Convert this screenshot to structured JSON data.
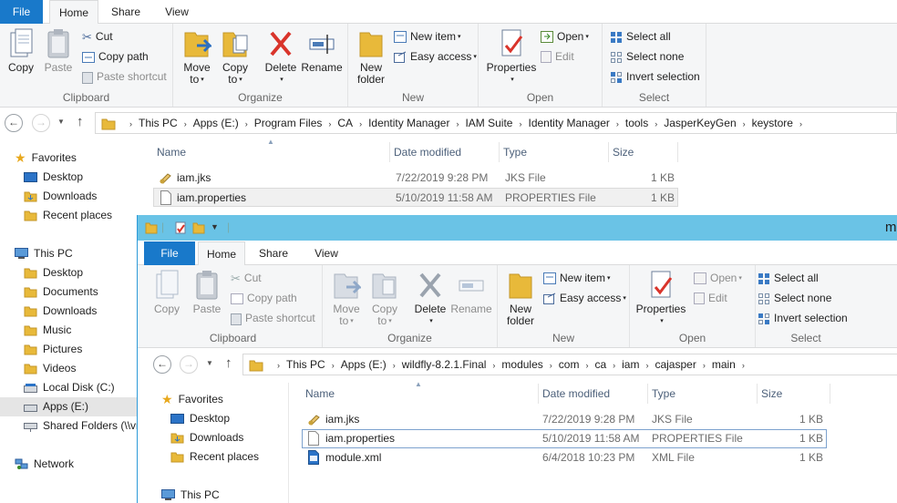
{
  "back_window": {
    "tabs": {
      "file": "File",
      "home": "Home",
      "share": "Share",
      "view": "View"
    },
    "ribbon": {
      "clipboard": {
        "label": "Clipboard",
        "copy": "Copy",
        "paste": "Paste",
        "cut": "Cut",
        "copy_path": "Copy path",
        "paste_shortcut": "Paste shortcut"
      },
      "organize": {
        "label": "Organize",
        "move_to": "Move",
        "move_to2": "to",
        "copy_to": "Copy",
        "copy_to2": "to",
        "delete": "Delete",
        "rename": "Rename"
      },
      "new": {
        "label": "New",
        "new_folder": "New",
        "new_folder2": "folder",
        "new_item": "New item",
        "easy_access": "Easy access"
      },
      "open": {
        "label": "Open",
        "properties": "Properties",
        "open": "Open",
        "edit": "Edit"
      },
      "select": {
        "label": "Select",
        "select_all": "Select all",
        "select_none": "Select none",
        "invert_selection": "Invert selection"
      }
    },
    "address": [
      "This PC",
      "Apps (E:)",
      "Program Files",
      "CA",
      "Identity Manager",
      "IAM Suite",
      "Identity Manager",
      "tools",
      "JasperKeyGen",
      "keystore"
    ],
    "nav": {
      "favorites": "Favorites",
      "desktop": "Desktop",
      "downloads": "Downloads",
      "recent": "Recent places",
      "this_pc": "This PC",
      "pc_desktop": "Desktop",
      "documents": "Documents",
      "pc_downloads": "Downloads",
      "music": "Music",
      "pictures": "Pictures",
      "videos": "Videos",
      "local_disk": "Local Disk (C:)",
      "apps": "Apps (E:)",
      "shared": "Shared Folders (\\\\vm",
      "network": "Network"
    },
    "columns": {
      "name": "Name",
      "date": "Date modified",
      "type": "Type",
      "size": "Size"
    },
    "files": [
      {
        "name": "iam.jks",
        "date": "7/22/2019 9:28 PM",
        "type": "JKS File",
        "size": "1 KB"
      },
      {
        "name": "iam.properties",
        "date": "5/10/2019 11:58 AM",
        "type": "PROPERTIES File",
        "size": "1 KB"
      }
    ]
  },
  "front_window": {
    "title": "ma",
    "tabs": {
      "file": "File",
      "home": "Home",
      "share": "Share",
      "view": "View"
    },
    "ribbon": {
      "clipboard": {
        "label": "Clipboard",
        "copy": "Copy",
        "paste": "Paste",
        "cut": "Cut",
        "copy_path": "Copy path",
        "paste_shortcut": "Paste shortcut"
      },
      "organize": {
        "label": "Organize",
        "move_to": "Move",
        "move_to2": "to",
        "copy_to": "Copy",
        "copy_to2": "to",
        "delete": "Delete",
        "rename": "Rename"
      },
      "new": {
        "label": "New",
        "new_folder": "New",
        "new_folder2": "folder",
        "new_item": "New item",
        "easy_access": "Easy access"
      },
      "open": {
        "label": "Open",
        "properties": "Properties",
        "open": "Open",
        "edit": "Edit"
      },
      "select": {
        "label": "Select",
        "select_all": "Select all",
        "select_none": "Select none",
        "invert_selection": "Invert selection"
      }
    },
    "address": [
      "This PC",
      "Apps (E:)",
      "wildfly-8.2.1.Final",
      "modules",
      "com",
      "ca",
      "iam",
      "cajasper",
      "main"
    ],
    "nav": {
      "favorites": "Favorites",
      "desktop": "Desktop",
      "downloads": "Downloads",
      "recent": "Recent places",
      "this_pc": "This PC"
    },
    "columns": {
      "name": "Name",
      "date": "Date modified",
      "type": "Type",
      "size": "Size"
    },
    "files": [
      {
        "name": "iam.jks",
        "date": "7/22/2019 9:28 PM",
        "type": "JKS File",
        "size": "1 KB"
      },
      {
        "name": "iam.properties",
        "date": "5/10/2019 11:58 AM",
        "type": "PROPERTIES File",
        "size": "1 KB"
      },
      {
        "name": "module.xml",
        "date": "6/4/2018 10:23 PM",
        "type": "XML File",
        "size": "1 KB"
      }
    ]
  },
  "colors": {
    "file_tab": "#1979ca",
    "title_bar": "#6ac3e6",
    "folder": "#e8b93a"
  }
}
